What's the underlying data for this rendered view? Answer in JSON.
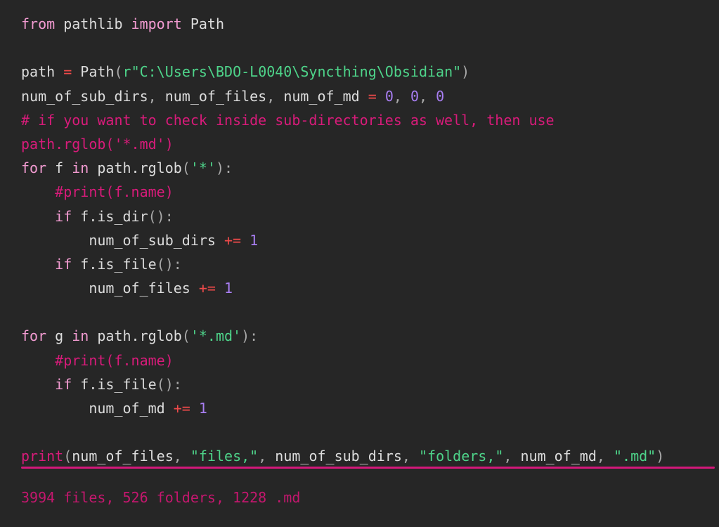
{
  "code": {
    "language": "python",
    "lines": [
      [
        {
          "t": "from",
          "k": "kw"
        },
        {
          "t": " pathlib ",
          "k": "id"
        },
        {
          "t": "import",
          "k": "kw"
        },
        {
          "t": " Path",
          "k": "id"
        }
      ],
      [],
      [
        {
          "t": "path ",
          "k": "id"
        },
        {
          "t": "=",
          "k": "op"
        },
        {
          "t": " Path",
          "k": "id"
        },
        {
          "t": "(",
          "k": "punc"
        },
        {
          "t": "r\"C:\\Users\\BDO-L0040\\Syncthing\\Obsidian\"",
          "k": "str"
        },
        {
          "t": ")",
          "k": "punc"
        }
      ],
      [
        {
          "t": "num_of_sub_dirs",
          "k": "id"
        },
        {
          "t": ", ",
          "k": "punc"
        },
        {
          "t": "num_of_files",
          "k": "id"
        },
        {
          "t": ", ",
          "k": "punc"
        },
        {
          "t": "num_of_md ",
          "k": "id"
        },
        {
          "t": "=",
          "k": "op"
        },
        {
          "t": " ",
          "k": "id"
        },
        {
          "t": "0",
          "k": "num"
        },
        {
          "t": ", ",
          "k": "punc"
        },
        {
          "t": "0",
          "k": "num"
        },
        {
          "t": ", ",
          "k": "punc"
        },
        {
          "t": "0",
          "k": "num"
        }
      ],
      [
        {
          "t": "# if you want to check inside sub-directories as well, then use",
          "k": "cm"
        }
      ],
      [
        {
          "t": "path.rglob('*.md')",
          "k": "cm"
        }
      ],
      [
        {
          "t": "for",
          "k": "kw"
        },
        {
          "t": " f ",
          "k": "id"
        },
        {
          "t": "in",
          "k": "kw"
        },
        {
          "t": " path.rglob",
          "k": "id"
        },
        {
          "t": "(",
          "k": "punc"
        },
        {
          "t": "'*'",
          "k": "str"
        },
        {
          "t": "):",
          "k": "punc"
        }
      ],
      [
        {
          "t": "    ",
          "k": "id"
        },
        {
          "t": "#print(f.name)",
          "k": "cm"
        }
      ],
      [
        {
          "t": "    ",
          "k": "id"
        },
        {
          "t": "if",
          "k": "kw"
        },
        {
          "t": " f.is_dir",
          "k": "id"
        },
        {
          "t": "():",
          "k": "punc"
        }
      ],
      [
        {
          "t": "        num_of_sub_dirs ",
          "k": "id"
        },
        {
          "t": "+=",
          "k": "op"
        },
        {
          "t": " ",
          "k": "id"
        },
        {
          "t": "1",
          "k": "num"
        }
      ],
      [
        {
          "t": "    ",
          "k": "id"
        },
        {
          "t": "if",
          "k": "kw"
        },
        {
          "t": " f.is_file",
          "k": "id"
        },
        {
          "t": "():",
          "k": "punc"
        }
      ],
      [
        {
          "t": "        num_of_files ",
          "k": "id"
        },
        {
          "t": "+=",
          "k": "op"
        },
        {
          "t": " ",
          "k": "id"
        },
        {
          "t": "1",
          "k": "num"
        }
      ],
      [],
      [
        {
          "t": "for",
          "k": "kw"
        },
        {
          "t": " g ",
          "k": "id"
        },
        {
          "t": "in",
          "k": "kw"
        },
        {
          "t": " path.rglob",
          "k": "id"
        },
        {
          "t": "(",
          "k": "punc"
        },
        {
          "t": "'*.md'",
          "k": "str"
        },
        {
          "t": "):",
          "k": "punc"
        }
      ],
      [
        {
          "t": "    ",
          "k": "id"
        },
        {
          "t": "#print(f.name)",
          "k": "cm"
        }
      ],
      [
        {
          "t": "    ",
          "k": "id"
        },
        {
          "t": "if",
          "k": "kw"
        },
        {
          "t": " f.is_file",
          "k": "id"
        },
        {
          "t": "():",
          "k": "punc"
        }
      ],
      [
        {
          "t": "        num_of_md ",
          "k": "id"
        },
        {
          "t": "+=",
          "k": "op"
        },
        {
          "t": " ",
          "k": "id"
        },
        {
          "t": "1",
          "k": "num"
        }
      ],
      [],
      [
        {
          "t": "print",
          "k": "fn"
        },
        {
          "t": "(",
          "k": "punc"
        },
        {
          "t": "num_of_files",
          "k": "id"
        },
        {
          "t": ", ",
          "k": "punc"
        },
        {
          "t": "\"files,\"",
          "k": "str"
        },
        {
          "t": ", ",
          "k": "punc"
        },
        {
          "t": "num_of_sub_dirs",
          "k": "id"
        },
        {
          "t": ", ",
          "k": "punc"
        },
        {
          "t": "\"folders,\"",
          "k": "str"
        },
        {
          "t": ", ",
          "k": "punc"
        },
        {
          "t": "num_of_md",
          "k": "id"
        },
        {
          "t": ", ",
          "k": "punc"
        },
        {
          "t": "\".md\"",
          "k": "str"
        },
        {
          "t": ")",
          "k": "punc"
        }
      ]
    ]
  },
  "output": {
    "text": "3994 files, 526 folders, 1228 .md"
  },
  "colors": {
    "background": "#262626",
    "keyword": "#f29bd1",
    "identifier": "#dcdcdc",
    "string": "#4ed48a",
    "number": "#a87ef2",
    "operator": "#ef4a4a",
    "comment": "#d81b7a",
    "divider": "#d3187a",
    "output": "#c4176e"
  }
}
